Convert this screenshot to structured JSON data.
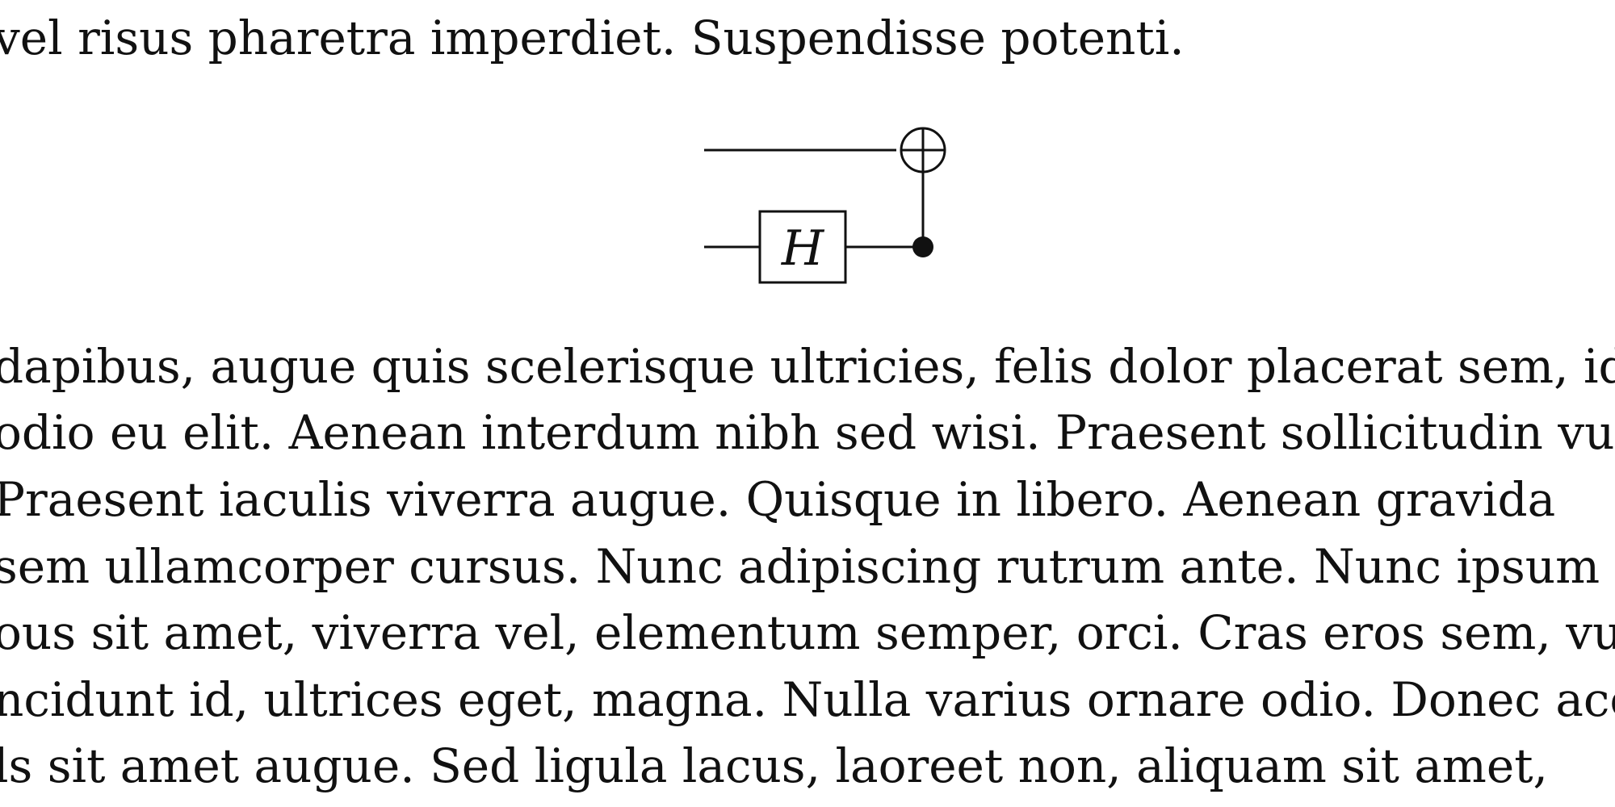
{
  "text_top": "vel risus pharetra imperdiet. Suspendisse potenti.",
  "paragraph_lines": [
    "dapibus, augue quis scelerisque ultricies, felis dolor placerat sem, id",
    "odio eu elit. Aenean interdum nibh sed wisi. Praesent sollicitudin vul",
    "Praesent iaculis viverra augue. Quisque in libero. Aenean gravida",
    "sem ullamcorper cursus. Nunc adipiscing rutrum ante. Nunc ipsum",
    "ous sit amet, viverra vel, elementum semper, orci. Cras eros sem, vu",
    "ncidunt id, ultrices eget, magna. Nulla varius ornare odio. Donec acc",
    "ls sit amet augue. Sed ligula lacus, laoreet non, aliquam sit amet,"
  ],
  "circuit": {
    "gate_label": "H"
  }
}
